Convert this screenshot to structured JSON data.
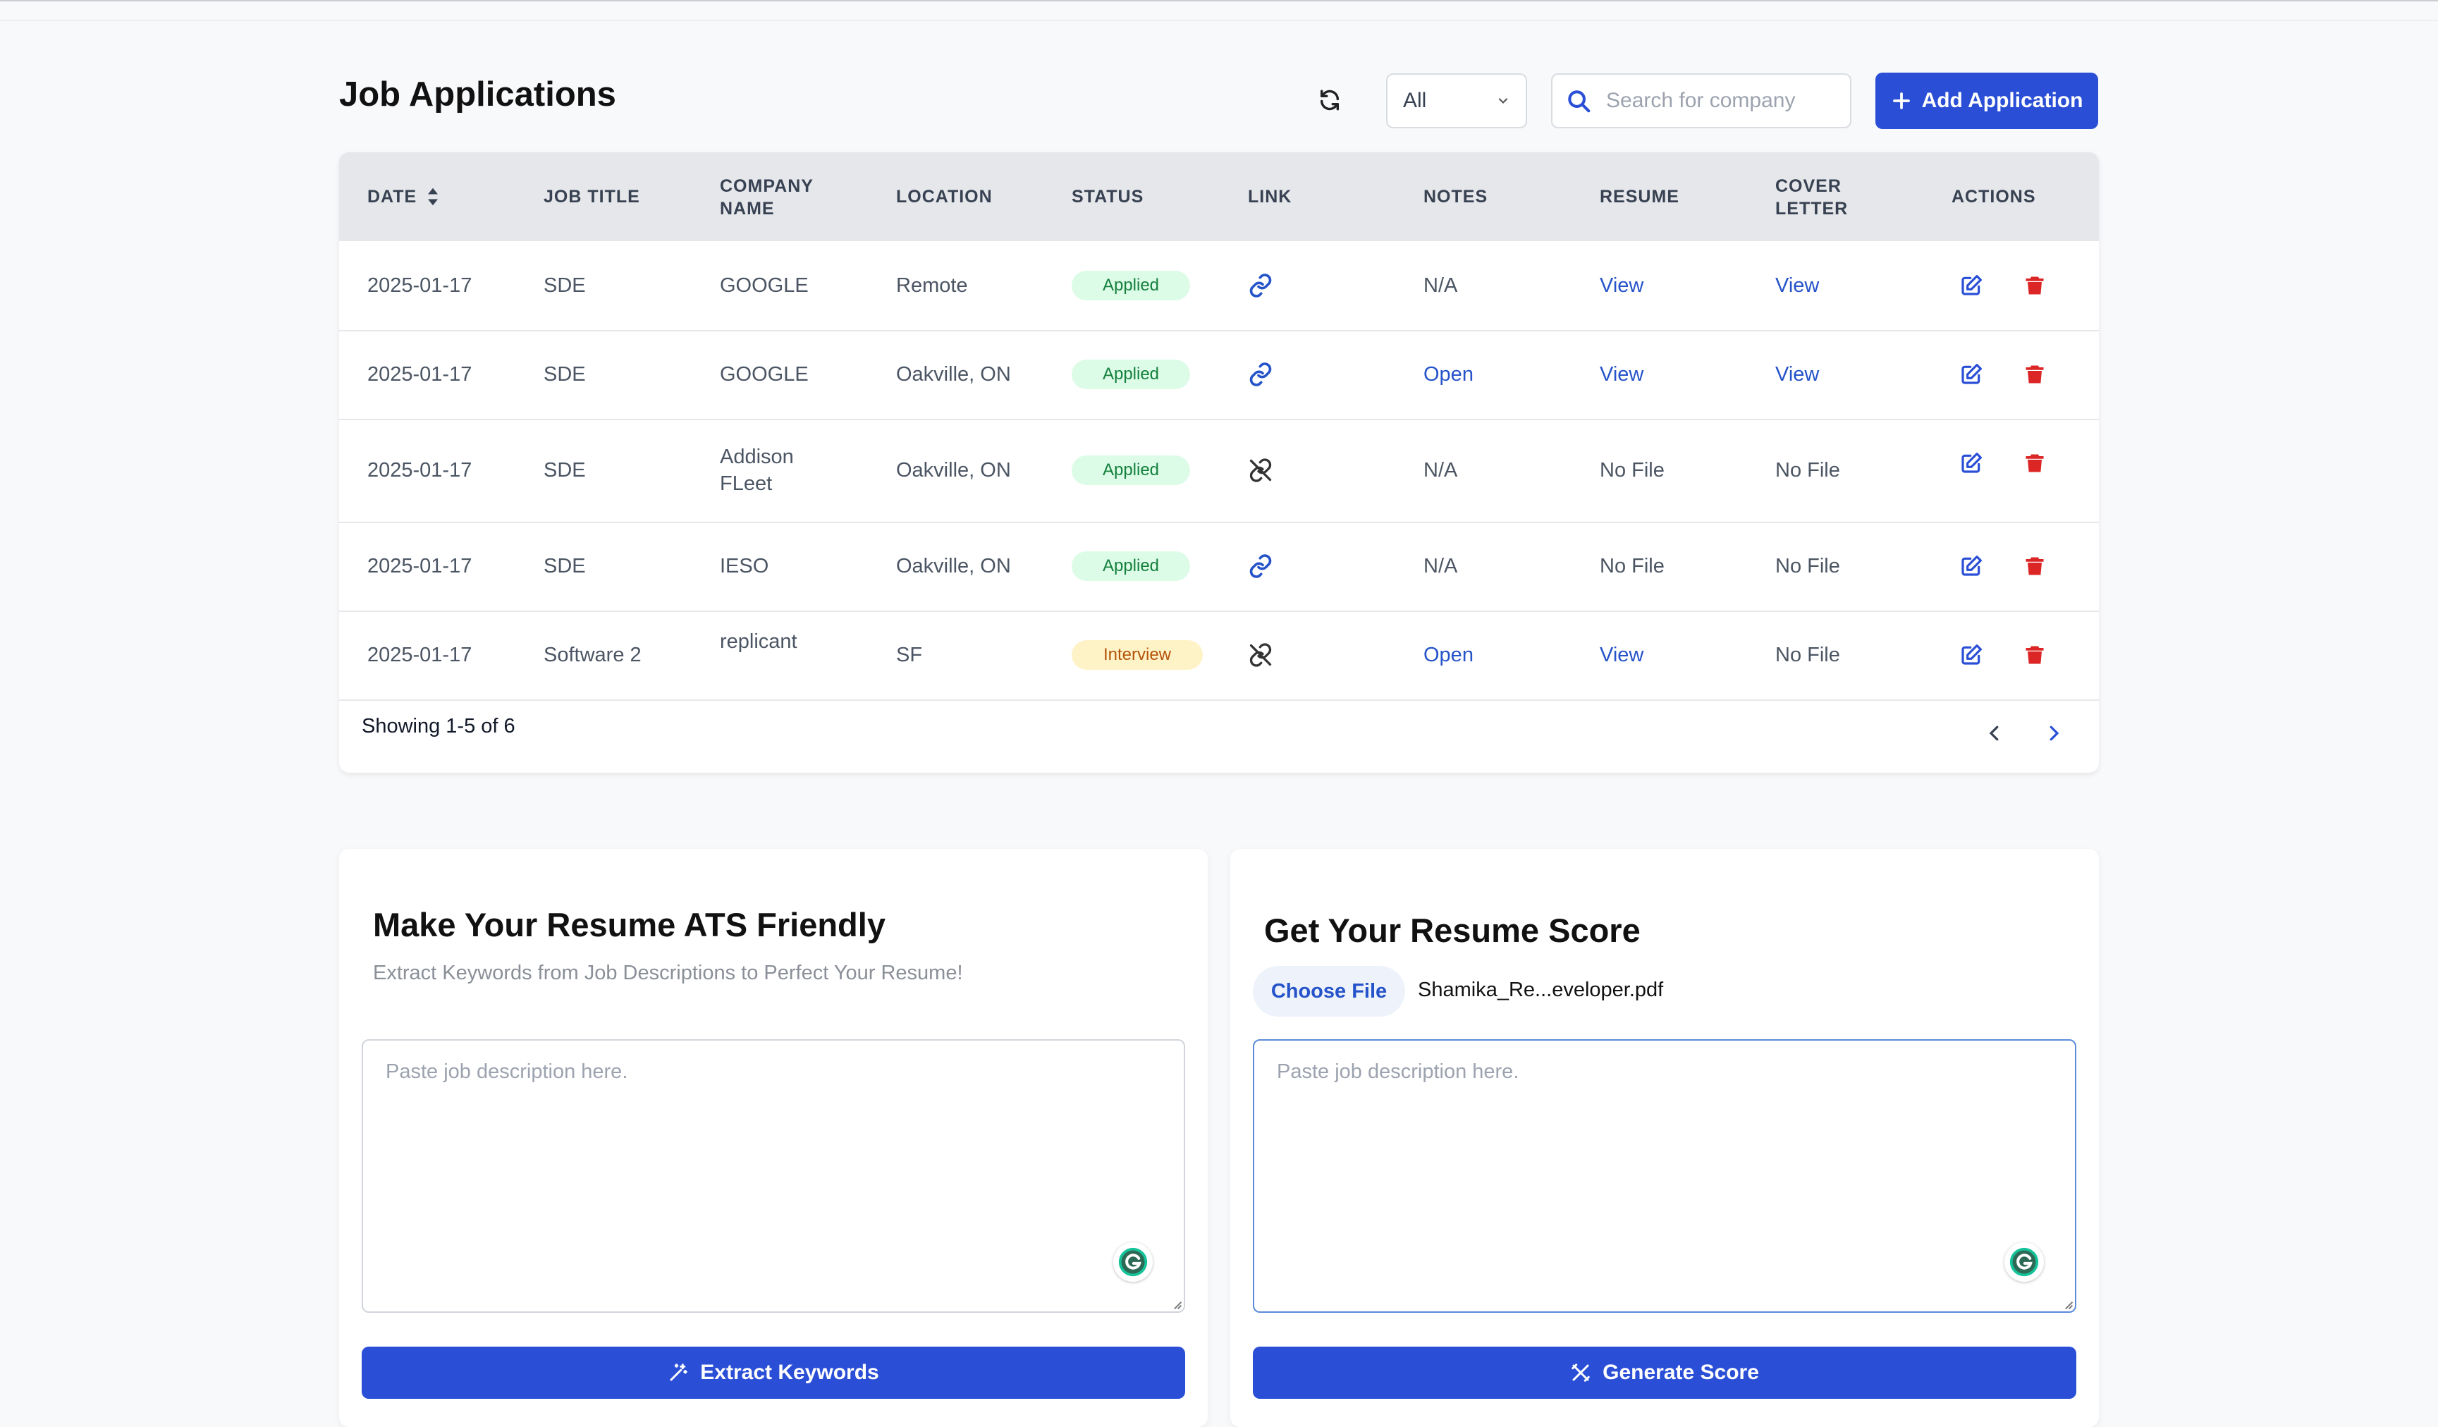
{
  "header": {
    "title": "Job Applications",
    "status_filter": {
      "selected": "All"
    },
    "search": {
      "placeholder": "Search for company"
    },
    "add_button_label": "Add Application"
  },
  "table": {
    "columns": [
      "DATE",
      "JOB TITLE",
      "COMPANY NAME",
      "LOCATION",
      "STATUS",
      "LINK",
      "NOTES",
      "RESUME",
      "COVER LETTER",
      "ACTIONS"
    ],
    "rows": [
      {
        "date": "2025-01-17",
        "title": "SDE",
        "company": "GOOGLE",
        "location": "Remote",
        "status": "Applied",
        "link": "link-icon",
        "notes": "N/A",
        "resume": "View",
        "cover": "View"
      },
      {
        "date": "2025-01-17",
        "title": "SDE",
        "company": "GOOGLE",
        "location": "Oakville, ON",
        "status": "Applied",
        "link": "link-icon",
        "notes": "Open",
        "resume": "View",
        "cover": "View"
      },
      {
        "date": "2025-01-17",
        "title": "SDE",
        "company": "Addison FLeet",
        "location": "Oakville, ON",
        "status": "Applied",
        "link": "unlink-icon",
        "notes": "N/A",
        "resume": "No File",
        "cover": "No File"
      },
      {
        "date": "2025-01-17",
        "title": "SDE",
        "company": "IESO",
        "location": "Oakville, ON",
        "status": "Applied",
        "link": "link-icon",
        "notes": "N/A",
        "resume": "No File",
        "cover": "No File"
      },
      {
        "date": "2025-01-17",
        "title": "Software 2",
        "company": "replicant",
        "location": "SF",
        "status": "Interview",
        "link": "unlink-icon",
        "notes": "Open",
        "resume": "View",
        "cover": "No File"
      }
    ],
    "pagination_text": "Showing 1-5 of 6"
  },
  "ats_panel": {
    "title": "Make Your Resume ATS Friendly",
    "subtitle": "Extract Keywords from Job Descriptions to Perfect Your Resume!",
    "textarea_placeholder": "Paste job description here.",
    "button_label": "Extract Keywords"
  },
  "score_panel": {
    "title": "Get Your Resume Score",
    "choose_file_label": "Choose File",
    "file_name": "Shamika_Re...eveloper.pdf",
    "textarea_placeholder": "Paste job description here.",
    "button_label": "Generate Score"
  },
  "colors": {
    "primary": "#2a4fd6",
    "link": "#2553c9",
    "delete": "#dc2626",
    "applied_bg": "#dcfce7",
    "interview_bg": "#fef3c7"
  }
}
